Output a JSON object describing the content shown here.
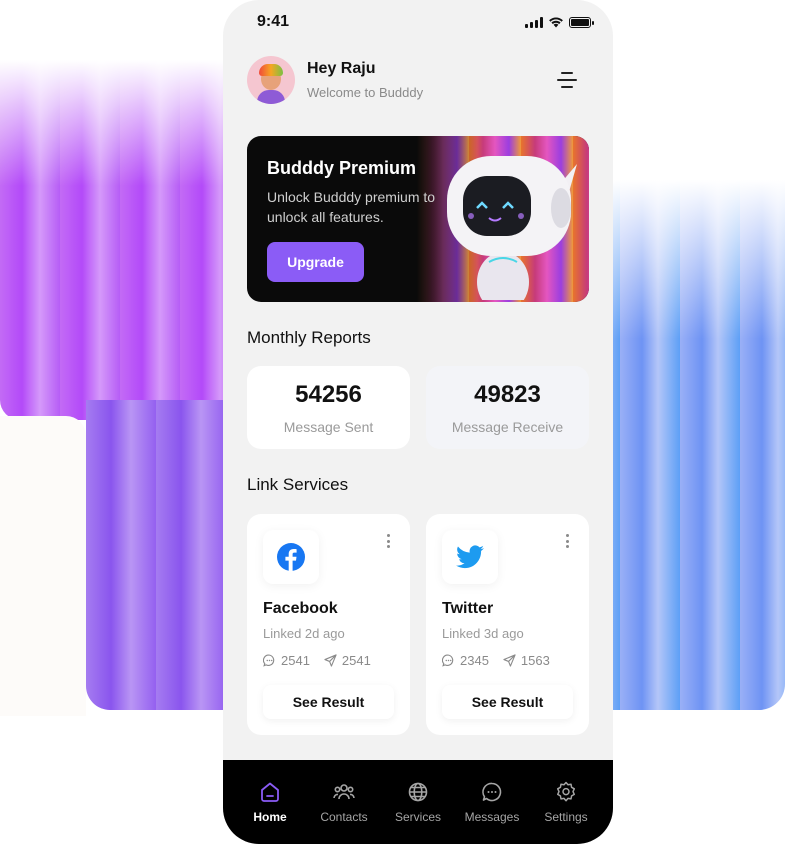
{
  "status_bar": {
    "time": "9:41"
  },
  "header": {
    "name": "Hey Raju",
    "subtitle": "Welcome to Budddy"
  },
  "banner": {
    "title": "Budddy Premium",
    "description": "Unlock Budddy premium to unlock all features.",
    "button_label": "Upgrade"
  },
  "monthly_reports": {
    "title": "Monthly Reports",
    "cards": [
      {
        "value": "54256",
        "label": "Message Sent"
      },
      {
        "value": "49823",
        "label": "Message Receive"
      }
    ]
  },
  "link_services": {
    "title": "Link Services",
    "cards": [
      {
        "name": "Facebook",
        "linked": "Linked 2d ago",
        "comments": "2541",
        "shares": "2541",
        "button_label": "See Result",
        "icon": "facebook-icon"
      },
      {
        "name": "Twitter",
        "linked": "Linked 3d ago",
        "comments": "2345",
        "shares": "1563",
        "button_label": "See Result",
        "icon": "twitter-icon"
      }
    ]
  },
  "tabbar": {
    "items": [
      {
        "label": "Home",
        "icon": "home-icon",
        "active": true
      },
      {
        "label": "Contacts",
        "icon": "contacts-icon",
        "active": false
      },
      {
        "label": "Services",
        "icon": "globe-icon",
        "active": false
      },
      {
        "label": "Messages",
        "icon": "message-icon",
        "active": false
      },
      {
        "label": "Settings",
        "icon": "gear-icon",
        "active": false
      }
    ]
  },
  "colors": {
    "accent": "#8b5cf6",
    "facebook": "#1877f2",
    "twitter": "#1d9bf0"
  }
}
